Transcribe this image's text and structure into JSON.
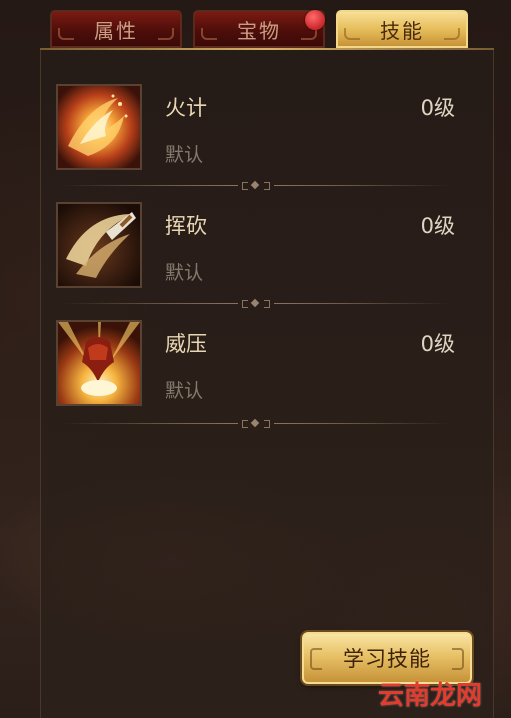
{
  "tabs": [
    {
      "label": "属性",
      "active": false
    },
    {
      "label": "宝物",
      "active": false,
      "has_notification": true
    },
    {
      "label": "技能",
      "active": true
    }
  ],
  "skills": [
    {
      "name": "火计",
      "level": "0级",
      "status": "默认",
      "icon": "fire-scheme-icon"
    },
    {
      "name": "挥砍",
      "level": "0级",
      "status": "默认",
      "icon": "blade-slash-icon"
    },
    {
      "name": "威压",
      "level": "0级",
      "status": "默认",
      "icon": "intimidate-icon"
    }
  ],
  "learn_button": {
    "label": "学习技能"
  },
  "watermark": {
    "text": "云南龙网"
  },
  "colors": {
    "active_tab": "#e7be5c",
    "inactive_tab": "#5a1009",
    "badge": "#d03a3a",
    "skill_name": "#e9d7b4",
    "skill_status": "#85796d"
  }
}
